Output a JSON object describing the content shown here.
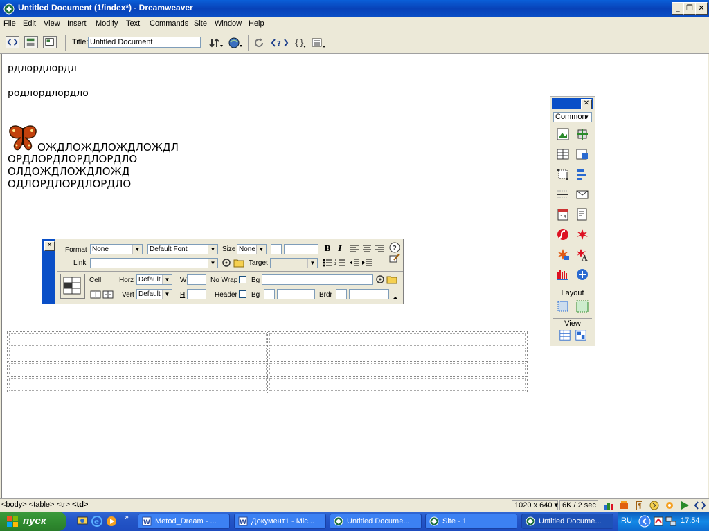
{
  "window": {
    "title": "Untitled Document (1/index*) - Dreamweaver"
  },
  "menu": [
    "File",
    "Edit",
    "View",
    "Insert",
    "Modify",
    "Text",
    "Commands",
    "Site",
    "Window",
    "Help"
  ],
  "toolbar": {
    "title_label": "Title:",
    "title_value": "Untitled Document"
  },
  "document": {
    "lines": [
      "рдлордлордл",
      "родлордлордло"
    ],
    "image_caption": "ОЖДЛОЖДЛОЖДЛОЖДЛ",
    "block_lines": [
      "ОРДЛОРДЛОРДЛОРДЛО",
      "ОЛДОЖДЛОЖДЛОЖД",
      "ОДЛОРДЛОРДЛОРДЛО"
    ]
  },
  "insert_panel": {
    "category": "Common",
    "layout_label": "Layout",
    "view_label": "View"
  },
  "property_inspector": {
    "format_label": "Format",
    "format_value": "None",
    "font_value": "Default Font",
    "size_label": "Size",
    "size_value": "None",
    "link_label": "Link",
    "target_label": "Target",
    "cell_label": "Cell",
    "horz_label": "Horz",
    "horz_value": "Default",
    "vert_label": "Vert",
    "vert_value": "Default",
    "w_label": "W",
    "h_label": "H",
    "nowrap_label": "No Wrap",
    "header_label": "Header",
    "bg_label": "Bg",
    "bg2_label": "Bg",
    "brdr_label": "Brdr",
    "bold": "B",
    "italic": "I"
  },
  "statusbar": {
    "tag_path": "<body> <table> <tr>",
    "tag_current": "<td>",
    "window_size": "1020 x 640",
    "download": "6K / 2 sec"
  },
  "taskbar": {
    "start_label": "пуск",
    "items": [
      "Metod_Dream - ...",
      "Документ1 - Mic...",
      "Untitled Docume...",
      "Site - 1",
      "Untitled Docume..."
    ],
    "lang": "RU",
    "clock": "17:54"
  }
}
